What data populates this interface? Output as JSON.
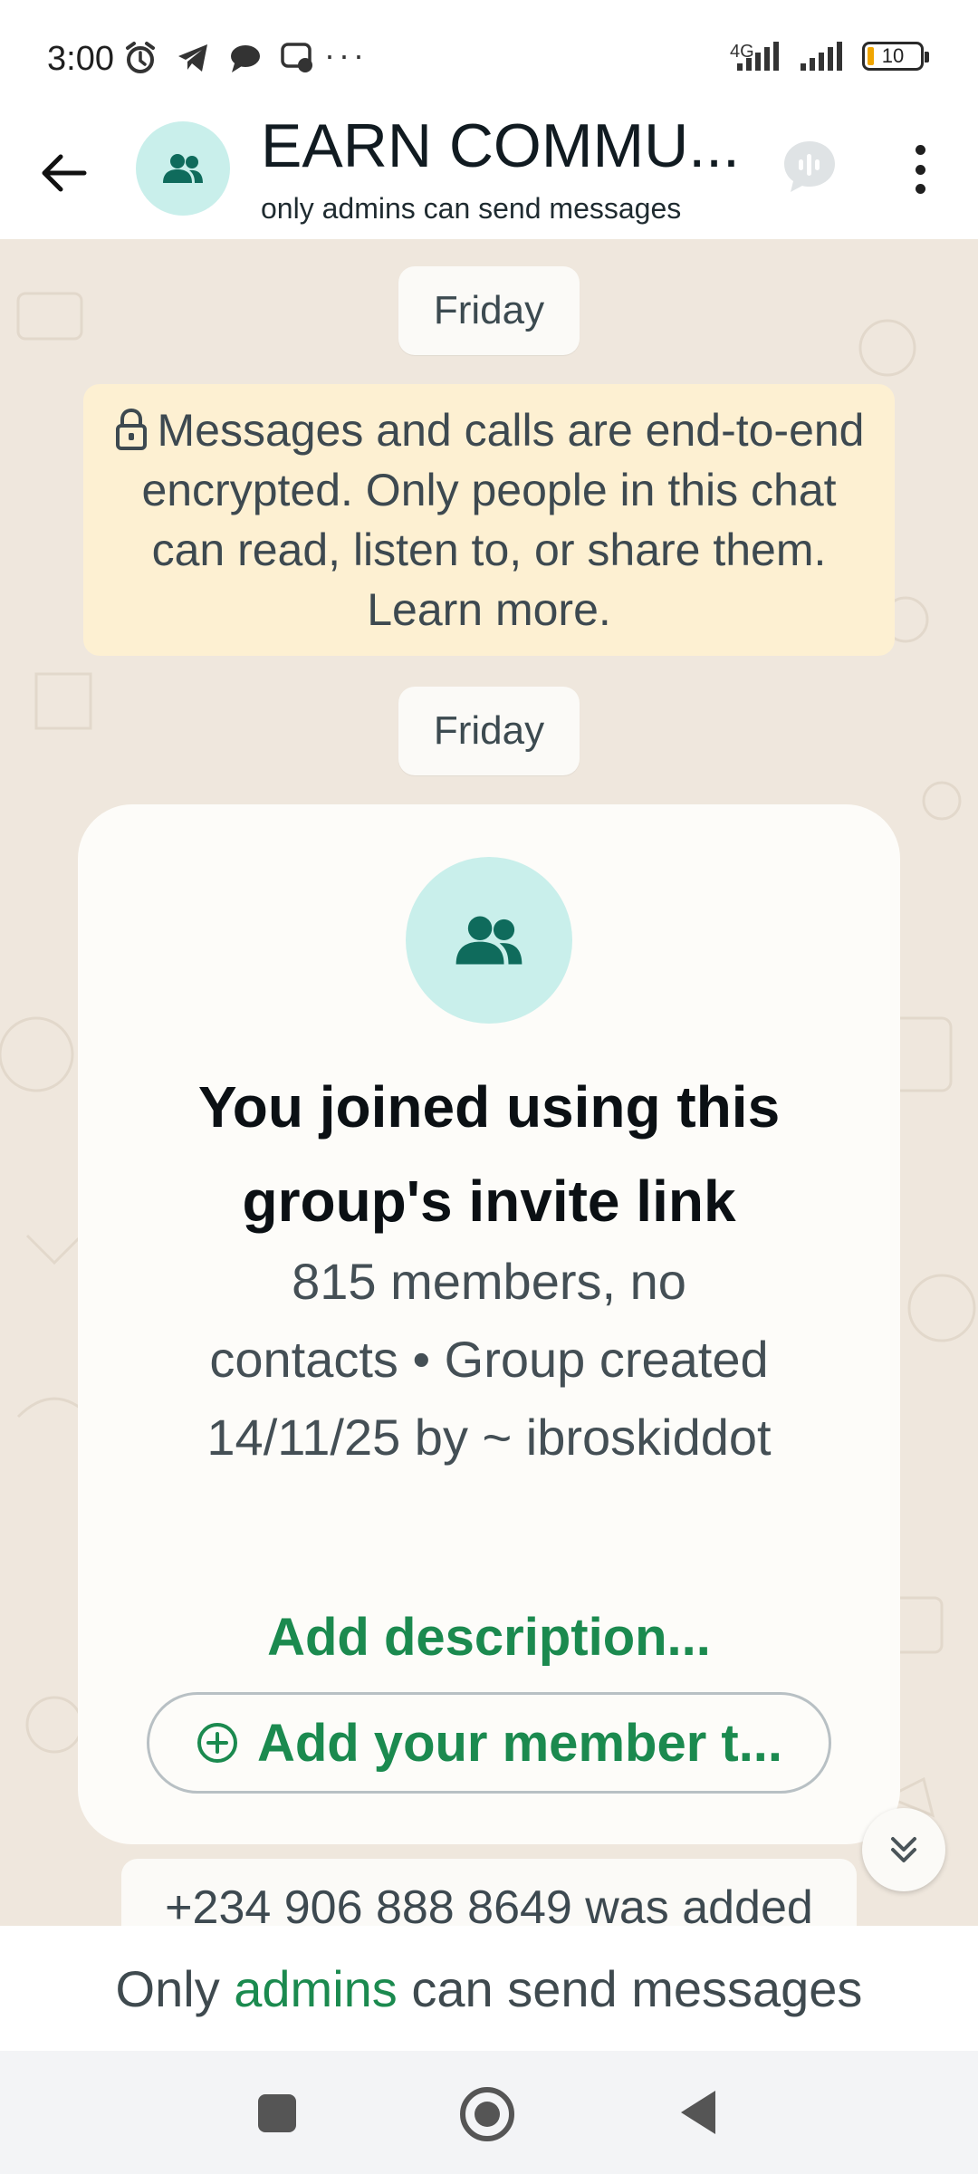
{
  "status_bar": {
    "time": "3:00",
    "network": "4G",
    "battery": "10",
    "overflow": "···"
  },
  "header": {
    "title": "EARN COMMU...",
    "subtitle": "only admins can send messages"
  },
  "chat": {
    "date_label_1": "Friday",
    "encryption_notice": "Messages and calls are end-to-end encrypted. Only people in this chat can read, listen to, or share them. Learn more.",
    "date_label_2": "Friday",
    "join_card": {
      "title": "You joined using this group's invite link",
      "meta": "815 members, no contacts • Group created 14/11/25 by ~ ibroskiddot",
      "add_description": "Add description...",
      "add_member_button": "Add your member t..."
    },
    "system_message": "+234 906 888 8649 was added"
  },
  "footer": {
    "prefix": "Only",
    "link": "admins",
    "suffix": "can send messages"
  },
  "colors": {
    "accent_green": "#1b8a4f",
    "avatar_bg": "#c9efeb",
    "avatar_icon": "#0f6b5c",
    "chat_bg": "#efe7dd",
    "encryption_bg": "#fdf0d2"
  }
}
